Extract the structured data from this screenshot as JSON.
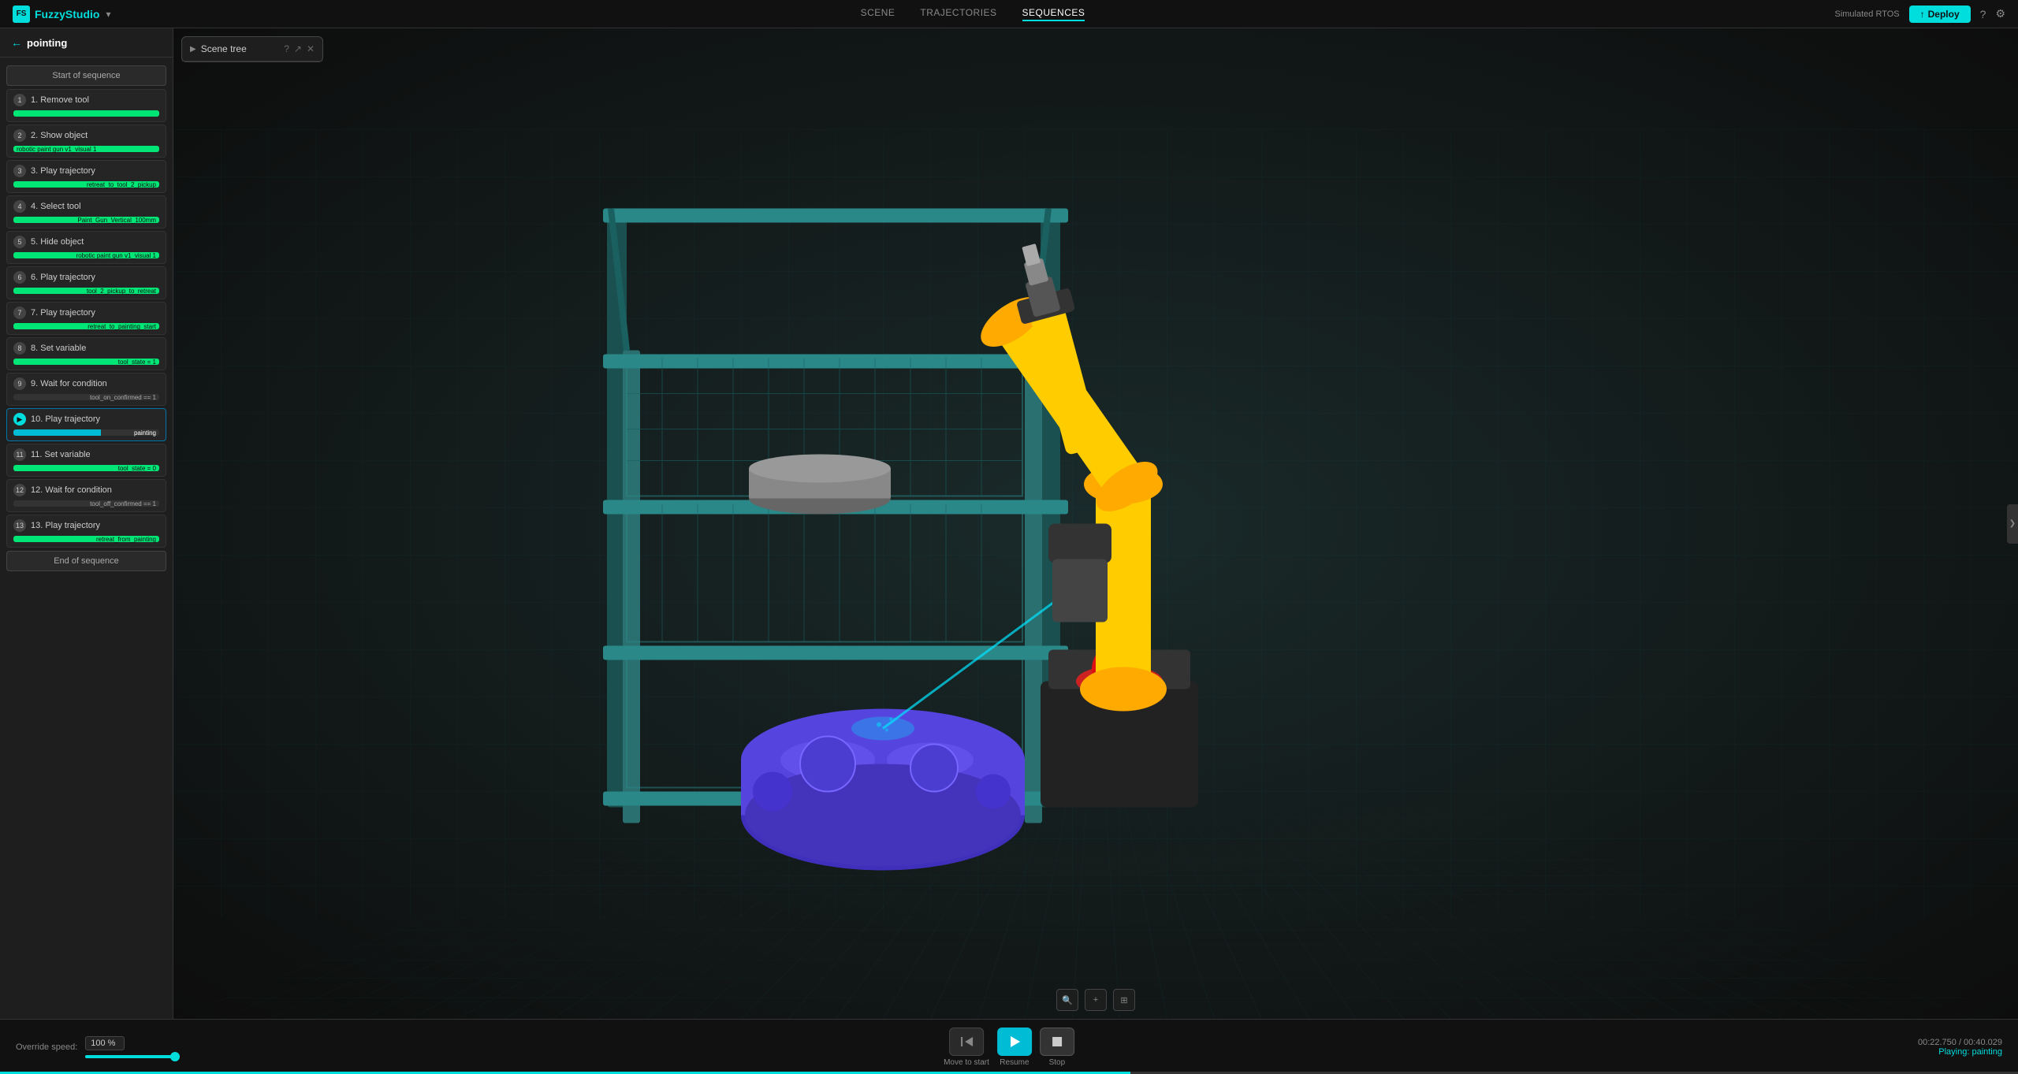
{
  "app": {
    "name": "FuzzyStudio",
    "logo_text": "FS"
  },
  "top_nav": {
    "items": [
      {
        "id": "scene",
        "label": "SCENE",
        "active": false
      },
      {
        "id": "trajectories",
        "label": "TRAJECTORIES",
        "active": false
      },
      {
        "id": "sequences",
        "label": "SEQUENCES",
        "active": true
      }
    ],
    "simulated_rtos_label": "Simulated RTOS",
    "deploy_label": "Deploy"
  },
  "sidebar": {
    "back_label": "←",
    "title": "pointing",
    "start_label": "Start of sequence",
    "end_label": "End of sequence",
    "items": [
      {
        "num": "1",
        "label": "1. Remove tool",
        "bar_class": "bar-green",
        "bar_width": "100%"
      },
      {
        "num": "2",
        "label": "2. Show object",
        "bar_text": "robotic paint gun v1_visual 1",
        "bar_class": "bar-green",
        "bar_width": "100%"
      },
      {
        "num": "3",
        "label": "3. Play trajectory",
        "bar_text": "retreat_to_tool_2_pickup",
        "bar_class": "bar-green",
        "bar_width": "100%"
      },
      {
        "num": "4",
        "label": "4. Select tool",
        "bar_text": "Paint_Gun_Vertical_100mm",
        "bar_class": "bar-green",
        "bar_width": "100%"
      },
      {
        "num": "5",
        "label": "5. Hide object",
        "bar_text": "robotic paint gun v1_visual 1",
        "bar_class": "bar-green",
        "bar_width": "100%"
      },
      {
        "num": "6",
        "label": "6. Play trajectory",
        "bar_text": "tool_2_pickup_to_retreat",
        "bar_class": "bar-green",
        "bar_width": "100%"
      },
      {
        "num": "7",
        "label": "7. Play trajectory",
        "bar_text": "retreat_to_painting_start",
        "bar_class": "bar-green",
        "bar_width": "100%"
      },
      {
        "num": "8",
        "label": "8. Set variable",
        "bar_text": "tool_state = 1",
        "bar_class": "bar-green",
        "bar_width": "100%"
      },
      {
        "num": "9",
        "label": "9. Wait for condition",
        "bar_text": "tool_on_confirmed == 1",
        "bar_class": "bar-gray",
        "bar_width": "60%"
      },
      {
        "num": "10",
        "label": "10. Play trajectory",
        "bar_text": "painting",
        "bar_class": "bar-blue",
        "bar_width": "60%"
      },
      {
        "num": "11",
        "label": "11. Set variable",
        "bar_text": "tool_state = 0",
        "bar_class": "bar-green",
        "bar_width": "100%"
      },
      {
        "num": "12",
        "label": "12. Wait for condition",
        "bar_text": "tool_off_confirmed == 1",
        "bar_class": "bar-gray",
        "bar_width": "60%"
      },
      {
        "num": "13",
        "label": "13. Play trajectory",
        "bar_text": "retreat_from_painting",
        "bar_class": "bar-green",
        "bar_width": "100%"
      }
    ]
  },
  "scene_tree": {
    "title": "Scene tree"
  },
  "viewport_controls": [
    {
      "icon": "🔍",
      "label": "zoom"
    },
    {
      "icon": "+",
      "label": "add"
    },
    {
      "icon": "⊞",
      "label": "grid"
    }
  ],
  "bottom_bar": {
    "override_label": "Override speed:",
    "override_value": "100 %",
    "move_to_start_label": "Move to start",
    "resume_label": "Resume",
    "stop_label": "Stop",
    "time_display": "00:22.750 / 00:40.029",
    "playing_label": "Playing: painting",
    "timeline_percent": 56
  }
}
